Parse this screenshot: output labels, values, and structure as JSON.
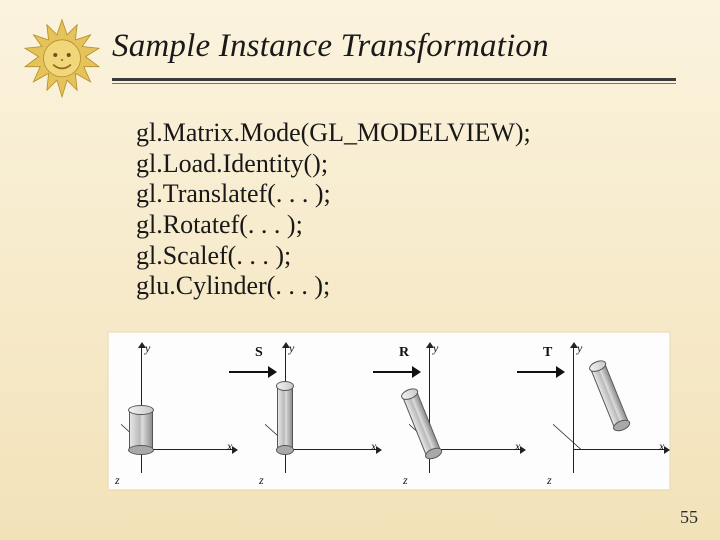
{
  "title": "Sample Instance Transformation",
  "code_lines": {
    "l0": "gl.Matrix.Mode(GL_MODELVIEW);",
    "l1": "gl.Load.Identity();",
    "l2": "gl.Translatef(. . . );",
    "l3": "gl.Rotatef(. . . );",
    "l4": "gl.Scalef(. . . );",
    "l5": "glu.Cylinder(. . . );"
  },
  "axes": {
    "x": "x",
    "y": "y",
    "z": "z"
  },
  "ops": {
    "s": "S",
    "r": "R",
    "t": "T"
  },
  "page_number": "55"
}
